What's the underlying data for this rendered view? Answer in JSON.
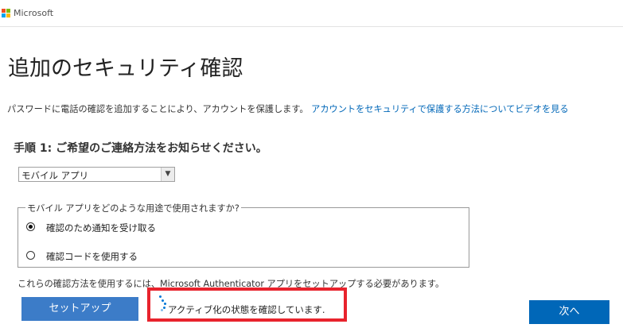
{
  "header": {
    "brand": "Microsoft",
    "logo_colors": [
      "#f25022",
      "#7fba00",
      "#00a4ef",
      "#ffb900"
    ]
  },
  "main": {
    "title": "追加のセキュリティ確認",
    "description": "パスワードに電話の確認を追加することにより、アカウントを保護します。",
    "video_link": "アカウントをセキュリティで保護する方法についてビデオを見る",
    "step_heading": "手順 1: ご希望のご連絡方法をお知らせください。",
    "contact_method": {
      "selected": "モバイル アプリ"
    },
    "usage_group": {
      "legend": "モバイル アプリをどのような用途で使用されますか?",
      "options": [
        {
          "label": "確認のため通知を受け取る",
          "checked": true
        },
        {
          "label": "確認コードを使用する",
          "checked": false
        }
      ]
    },
    "setup_note": "これらの確認方法を使用するには、Microsoft Authenticator アプリをセットアップする必要があります。",
    "setup_button": "セットアップ",
    "status_text": "アクティブ化の状態を確認しています.",
    "next_button": "次へ"
  },
  "colors": {
    "link": "#0067b8",
    "setup_button": "#3c7cc8",
    "next_button": "#0067b8",
    "highlight_border": "#e8232d"
  }
}
